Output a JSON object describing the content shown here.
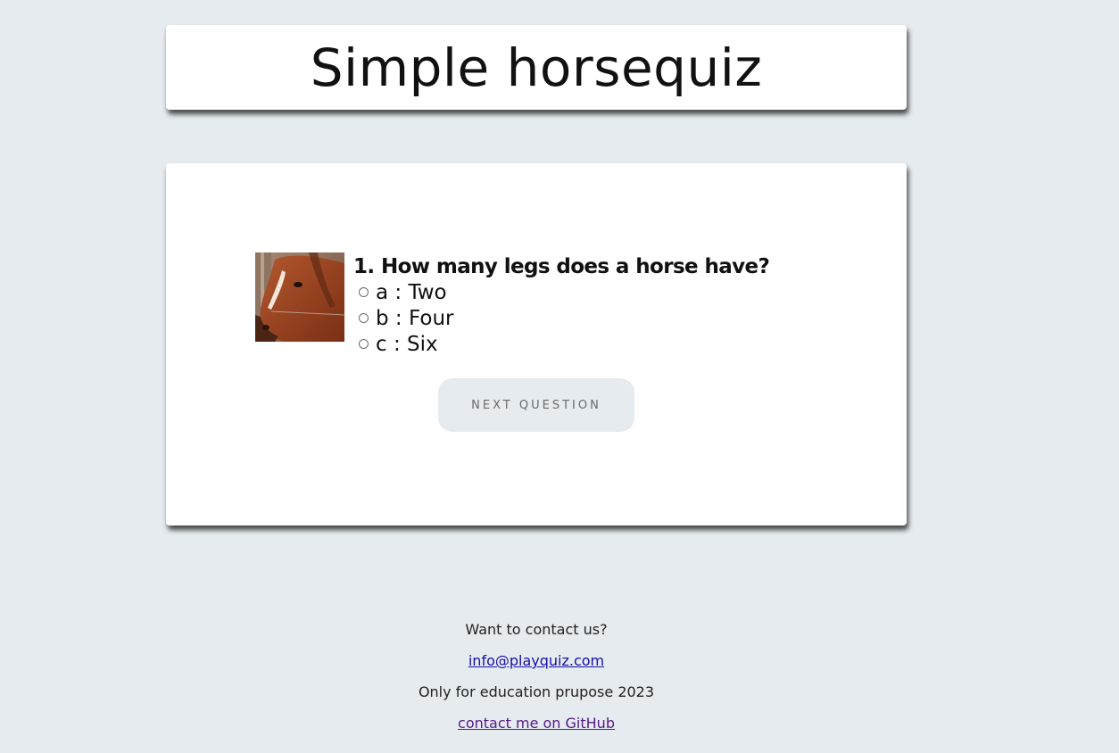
{
  "header": {
    "title": "Simple horsequiz"
  },
  "quiz": {
    "image_icon": "horse-head-photo",
    "question": "1. How many legs does a horse have?",
    "options": [
      {
        "label": "a : Two",
        "selected": false
      },
      {
        "label": "b : Four",
        "selected": false
      },
      {
        "label": "c : Six",
        "selected": false
      }
    ],
    "next_label": "NEXT QUESTION"
  },
  "footer": {
    "contact_prompt": "Want to contact us?",
    "email": "info@playquiz.com",
    "education_note": "Only for education prupose 2023",
    "github_link": "contact me on GitHub"
  },
  "colors": {
    "background": "#e6ebef",
    "card": "#ffffff",
    "button_bg": "#e6ebef",
    "button_text": "#6a6a6a",
    "link": "#1a0dab",
    "visited_link": "#551a8b"
  }
}
